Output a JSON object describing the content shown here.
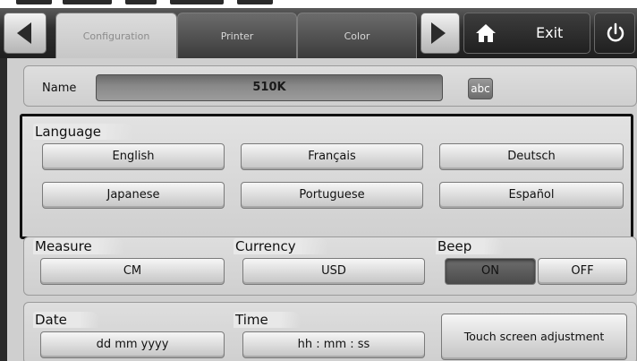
{
  "toolbar": {
    "tabs": [
      {
        "label": "Configuration",
        "active": true
      },
      {
        "label": "Printer",
        "active": false
      },
      {
        "label": "Color",
        "active": false
      }
    ],
    "exit_label": "Exit",
    "icons": {
      "prev": "arrow-left-icon",
      "next": "arrow-right-icon",
      "home": "home-icon",
      "power": "power-icon"
    }
  },
  "name_row": {
    "label": "Name",
    "value": "510K",
    "keyboard_button": "abc"
  },
  "language": {
    "label": "Language",
    "options": [
      "English",
      "Français",
      "Deutsch",
      "Japanese",
      "Portuguese",
      "Español"
    ]
  },
  "measure": {
    "label": "Measure",
    "value": "CM"
  },
  "currency": {
    "label": "Currency",
    "value": "USD"
  },
  "beep": {
    "label": "Beep",
    "on_label": "ON",
    "off_label": "OFF",
    "selected": "ON"
  },
  "date": {
    "label": "Date",
    "value": "dd mm yyyy"
  },
  "time": {
    "label": "Time",
    "value": "hh : mm : ss"
  },
  "touch_adjust_label": "Touch screen adjustment",
  "colors": {
    "toolbar_bg": "#2a2a2a",
    "panel_bg": "#cfcfcf",
    "selected_button": "#5a5a5a"
  }
}
